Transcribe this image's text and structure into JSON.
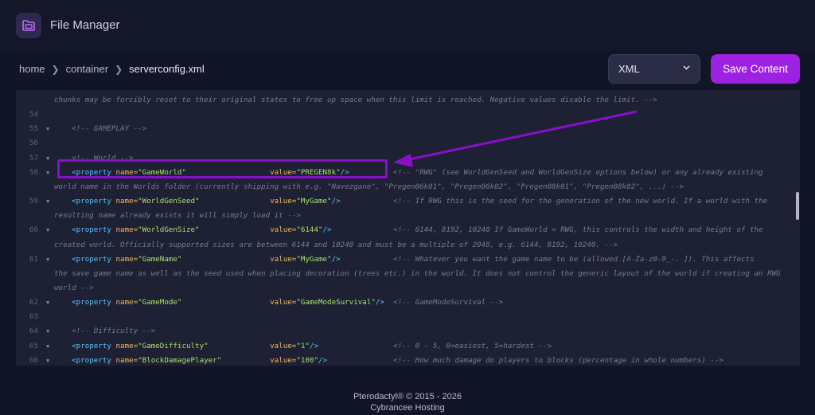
{
  "app": {
    "title": "File Manager"
  },
  "breadcrumb": {
    "home": "home",
    "container": "container",
    "file": "serverconfig.xml"
  },
  "toolbar": {
    "mode_selected": "XML",
    "save_label": "Save Content"
  },
  "editor": {
    "lines": [
      {
        "no": "",
        "fold": false,
        "parts": [
          [
            "cm",
            "chunks may be forcibly reset to their original states to free up space when this limit is reached. Negative values disable the limit. -->"
          ]
        ]
      },
      {
        "no": "54",
        "fold": false,
        "parts": []
      },
      {
        "no": "55",
        "fold": true,
        "parts": [
          [
            "cm",
            "    <!-- GAMEPLAY -->"
          ]
        ]
      },
      {
        "no": "56",
        "fold": false,
        "parts": []
      },
      {
        "no": "57",
        "fold": true,
        "parts": [
          [
            "cm",
            "    <!-- World -->"
          ]
        ]
      },
      {
        "no": "58",
        "fold": true,
        "parts": [
          [
            "txt",
            "    "
          ],
          [
            "tag",
            "<property "
          ],
          [
            "attr",
            "name="
          ],
          [
            "str",
            "\"GameWorld\""
          ],
          [
            "txt",
            "                   "
          ],
          [
            "attr",
            "value="
          ],
          [
            "str",
            "\"PREGEN8k\""
          ],
          [
            "tag",
            "/>"
          ],
          [
            "txt",
            "          "
          ],
          [
            "cm",
            "<!-- \"RWG\" (see WorldGenSeed and WorldGenSize options below) or any already existing"
          ]
        ]
      },
      {
        "no": "",
        "fold": false,
        "parts": [
          [
            "cm",
            "world name in the Worlds folder (currently shipping with e.g. \"Navezgane\", \"Pregen06k01\", \"Pregen06k02\", \"Pregen08k01\", \"Pregen08k02\", ...) -->"
          ]
        ]
      },
      {
        "no": "59",
        "fold": true,
        "parts": [
          [
            "txt",
            "    "
          ],
          [
            "tag",
            "<property "
          ],
          [
            "attr",
            "name="
          ],
          [
            "str",
            "\"WorldGenSeed\""
          ],
          [
            "txt",
            "                "
          ],
          [
            "attr",
            "value="
          ],
          [
            "str",
            "\"MyGame\""
          ],
          [
            "tag",
            "/>"
          ],
          [
            "txt",
            "            "
          ],
          [
            "cm",
            "<!-- If RWG this is the seed for the generation of the new world. If a world with the"
          ]
        ]
      },
      {
        "no": "",
        "fold": false,
        "parts": [
          [
            "cm",
            "resulting name already exists it will simply load it -->"
          ]
        ]
      },
      {
        "no": "60",
        "fold": true,
        "parts": [
          [
            "txt",
            "    "
          ],
          [
            "tag",
            "<property "
          ],
          [
            "attr",
            "name="
          ],
          [
            "str",
            "\"WorldGenSize\""
          ],
          [
            "txt",
            "                "
          ],
          [
            "attr",
            "value="
          ],
          [
            "str",
            "\"6144\""
          ],
          [
            "tag",
            "/>"
          ],
          [
            "txt",
            "              "
          ],
          [
            "cm",
            "<!-- 6144, 8192, 10240 If GameWorld = RWG, this controls the width and height of the"
          ]
        ]
      },
      {
        "no": "",
        "fold": false,
        "parts": [
          [
            "cm",
            "created world. Officially supported sizes are between 6144 and 10240 and must be a multiple of 2048, e.g. 6144, 8192, 10240. -->"
          ]
        ]
      },
      {
        "no": "61",
        "fold": true,
        "parts": [
          [
            "txt",
            "    "
          ],
          [
            "tag",
            "<property "
          ],
          [
            "attr",
            "name="
          ],
          [
            "str",
            "\"GameName\""
          ],
          [
            "txt",
            "                    "
          ],
          [
            "attr",
            "value="
          ],
          [
            "str",
            "\"MyGame\""
          ],
          [
            "tag",
            "/>"
          ],
          [
            "txt",
            "            "
          ],
          [
            "cm",
            "<!-- Whatever you want the game name to be (allowed [A-Za-z0-9_-. ]). This affects"
          ]
        ]
      },
      {
        "no": "",
        "fold": false,
        "parts": [
          [
            "cm",
            "the save game name as well as the seed used when placing decoration (trees etc.) in the world. It does not control the generic layout of the world if creating an RWG"
          ]
        ]
      },
      {
        "no": "",
        "fold": false,
        "parts": [
          [
            "cm",
            "world -->"
          ]
        ]
      },
      {
        "no": "62",
        "fold": true,
        "parts": [
          [
            "txt",
            "    "
          ],
          [
            "tag",
            "<property "
          ],
          [
            "attr",
            "name="
          ],
          [
            "str",
            "\"GameMode\""
          ],
          [
            "txt",
            "                    "
          ],
          [
            "attr",
            "value="
          ],
          [
            "str",
            "\"GameModeSurvival\""
          ],
          [
            "tag",
            "/>"
          ],
          [
            "txt",
            "  "
          ],
          [
            "cm",
            "<!-- GameModeSurvival -->"
          ]
        ]
      },
      {
        "no": "63",
        "fold": false,
        "parts": []
      },
      {
        "no": "64",
        "fold": true,
        "parts": [
          [
            "cm",
            "    <!-- Difficulty -->"
          ]
        ]
      },
      {
        "no": "65",
        "fold": true,
        "parts": [
          [
            "txt",
            "    "
          ],
          [
            "tag",
            "<property "
          ],
          [
            "attr",
            "name="
          ],
          [
            "str",
            "\"GameDifficulty\""
          ],
          [
            "txt",
            "              "
          ],
          [
            "attr",
            "value="
          ],
          [
            "str",
            "\"1\""
          ],
          [
            "tag",
            "/>"
          ],
          [
            "txt",
            "                 "
          ],
          [
            "cm",
            "<!-- 0 - 5, 0=easiest, 5=hardest -->"
          ]
        ]
      },
      {
        "no": "66",
        "fold": true,
        "parts": [
          [
            "txt",
            "    "
          ],
          [
            "tag",
            "<property "
          ],
          [
            "attr",
            "name="
          ],
          [
            "str",
            "\"BlockDamagePlayer\""
          ],
          [
            "txt",
            "           "
          ],
          [
            "attr",
            "value="
          ],
          [
            "str",
            "\"100\""
          ],
          [
            "tag",
            "/>"
          ],
          [
            "txt",
            "               "
          ],
          [
            "cm",
            "<!-- How much damage do players to blocks (percentage in whole numbers) -->"
          ]
        ]
      }
    ]
  },
  "colors": {
    "accent": "#9d21e0",
    "annotation": "#8a0fc8",
    "background": "#121427",
    "editor_bg": "#1e2033"
  },
  "footer": {
    "line1": "Pterodactyl® © 2015 - 2026",
    "line2": "Cybrancee Hosting"
  }
}
